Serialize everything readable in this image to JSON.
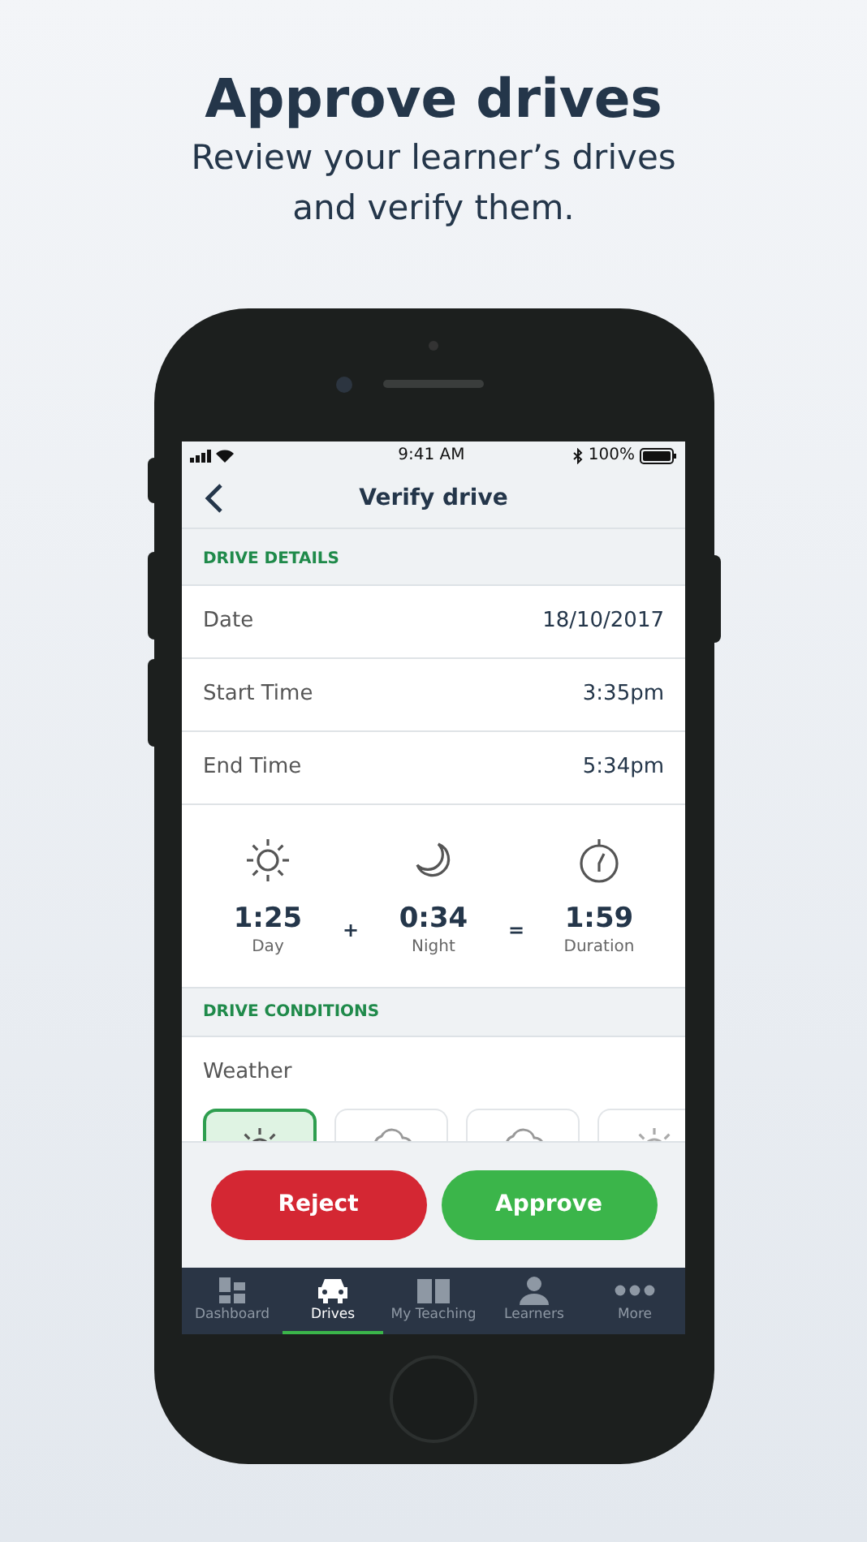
{
  "headline": {
    "title": "Approve drives",
    "subtitle": "Review your learner’s drives and verify them."
  },
  "status_bar": {
    "time": "9:41 AM",
    "battery": "100%"
  },
  "nav": {
    "title": "Verify drive"
  },
  "sections": [
    {
      "heading": "DRIVE DETAILS"
    },
    {
      "heading": "DRIVE CONDITIONS"
    }
  ],
  "details": [
    {
      "label": "Date",
      "value": "18/10/2017"
    },
    {
      "label": "Start Time",
      "value": "3:35pm"
    },
    {
      "label": "End Time",
      "value": "5:34pm"
    }
  ],
  "summary": [
    {
      "value": "1:25",
      "label": "Day",
      "operator": "+"
    },
    {
      "value": "0:34",
      "label": "Night",
      "operator": "="
    },
    {
      "value": "1:59",
      "label": "Duration"
    }
  ],
  "weather": {
    "label": "Weather",
    "options": [
      {
        "selected": true
      },
      {
        "selected": false
      },
      {
        "selected": false
      },
      {
        "selected": false
      }
    ]
  },
  "actions": [
    {
      "label": "Reject",
      "kind": "reject"
    },
    {
      "label": "Approve",
      "kind": "approve"
    }
  ],
  "tabs": [
    {
      "label": "Dashboard",
      "selected": false
    },
    {
      "label": "Drives",
      "selected": true
    },
    {
      "label": "My Teaching",
      "selected": false
    },
    {
      "label": "Learners",
      "selected": false
    },
    {
      "label": "More",
      "selected": false
    }
  ]
}
